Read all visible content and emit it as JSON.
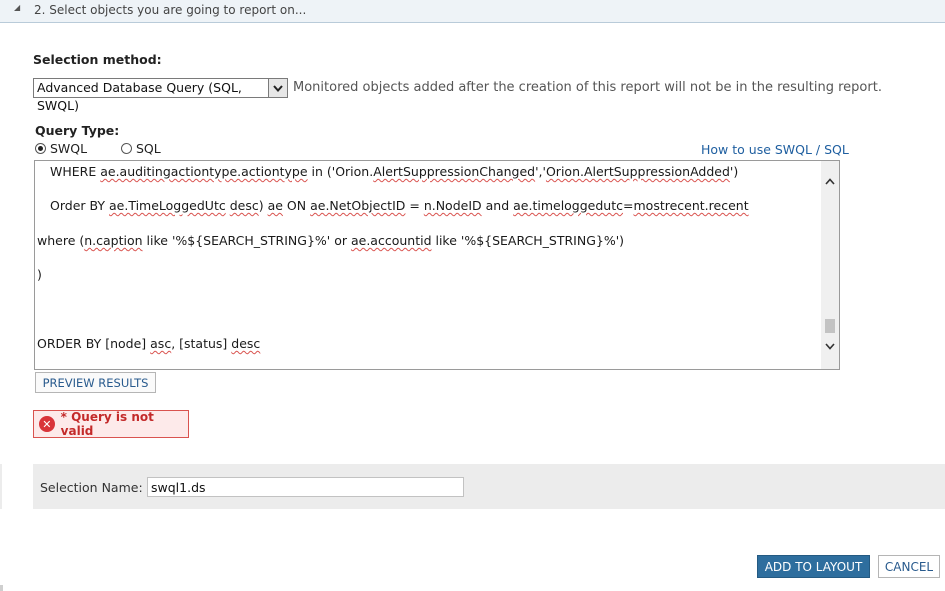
{
  "section": {
    "title": "2. Select objects you are going to report on...",
    "collapse_icon": "triangle-down-icon"
  },
  "selection_method": {
    "label": "Selection method:",
    "value": "Advanced Database Query (SQL, SWQL)",
    "note": "Monitored objects added after the creation of this report will not be in the resulting report."
  },
  "query_type": {
    "label": "Query Type:",
    "options": [
      "SWQL",
      "SQL"
    ],
    "selected": "SWQL",
    "help_link": "How to use SWQL / SQL"
  },
  "editor": {
    "lines": [
      {
        "p1": "WHERE ",
        "s1": "ae.auditingactiontype.actiontype",
        "p2": " in ('Orion.",
        "s2": "AlertSuppressionChanged",
        "p3": "','",
        "s3": "Orion.AlertSuppressionAdded",
        "p4": "')"
      },
      {
        "p1": "Order BY ",
        "s1": "ae.TimeLoggedUtc",
        "p2": " ",
        "s2": "desc",
        "p3": ") ",
        "s3": "ae",
        "p4": " ON ",
        "s4": "ae.NetObjectID",
        "p5": " = ",
        "s5": "n.NodeID",
        "p6": " and ",
        "s6": "ae.timeloggedutc",
        "p7": "=",
        "s7": "mostrecent.recent"
      },
      {
        "p1": "where (",
        "s1": "n.caption",
        "p2": " like '%${SEARCH_STRING}%' or ",
        "s2": "ae.accountid",
        "p3": " like '%${SEARCH_STRING}%')"
      },
      {
        "p1": ")"
      },
      {
        "p1": "ORDER BY [node] ",
        "s1": "asc",
        "p2": ", [status] ",
        "s2": "desc"
      }
    ]
  },
  "preview_button": "PREVIEW RESULTS",
  "error": {
    "icon": "error-x-icon",
    "message": "* Query is not valid"
  },
  "selection_name": {
    "label": "Selection Name:",
    "value": "swql1.ds"
  },
  "buttons": {
    "add": "ADD TO LAYOUT",
    "cancel": "CANCEL"
  },
  "colors": {
    "accent": "#2e6e9e",
    "link": "#1f5fa0",
    "error": "#c32a2a"
  }
}
